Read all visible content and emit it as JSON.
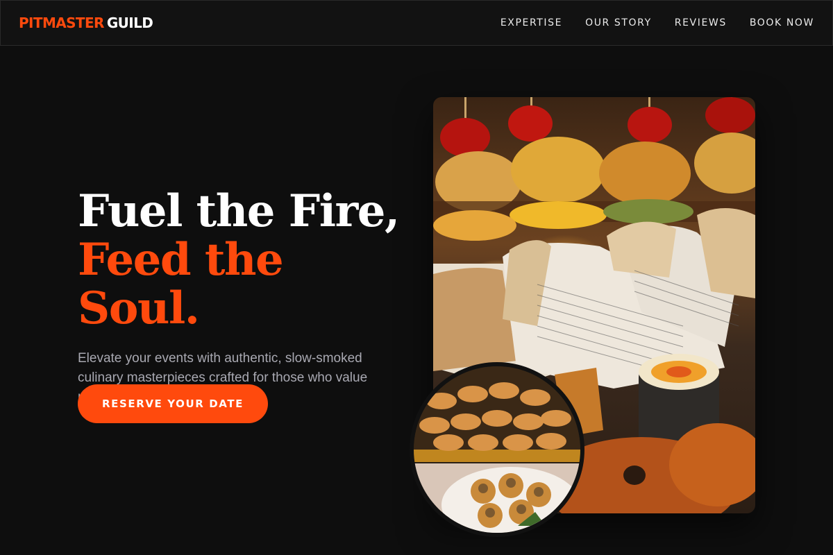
{
  "header": {
    "brand_part1": "PITMASTER",
    "brand_part2": "GUILD",
    "nav": [
      {
        "label": "EXPERTISE"
      },
      {
        "label": "OUR STORY"
      },
      {
        "label": "REVIEWS"
      },
      {
        "label": "BOOK NOW"
      }
    ]
  },
  "hero": {
    "headline_line1": "Fuel the Fire,",
    "headline_line2": "Feed the Soul.",
    "subtext": "Elevate your events with authentic, slow-smoked culinary masterpieces crafted for those who value real flavor and tradition.",
    "cta_label": "RESERVE YOUR DATE"
  },
  "colors": {
    "accent": "#ff4a0d",
    "background": "#0e0e0e",
    "header_bg": "#121212",
    "subtext": "#a9a9b2"
  }
}
